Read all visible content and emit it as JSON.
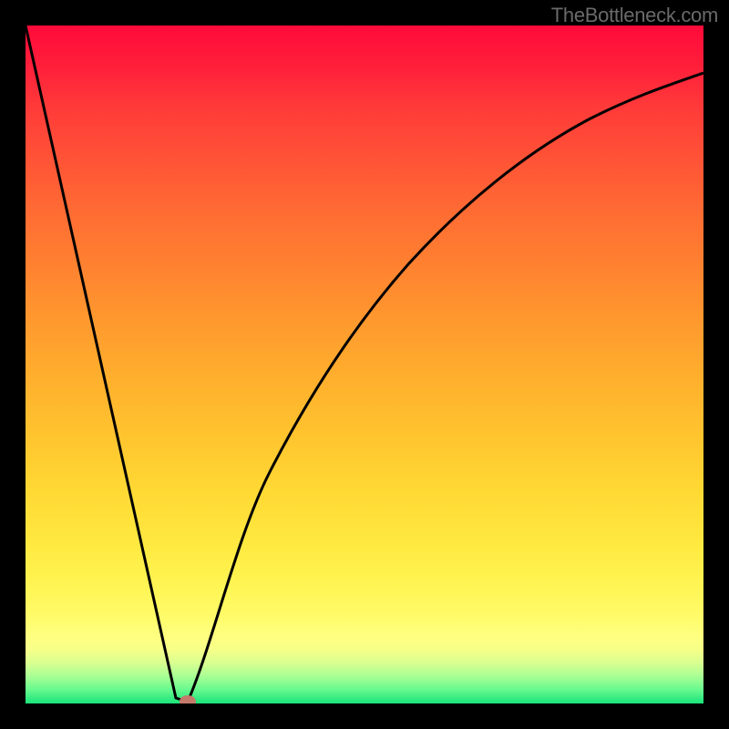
{
  "attribution": "TheBottleneck.com",
  "colors": {
    "page_bg": "#000000",
    "gradient_top": "#ff0a3a",
    "gradient_bottom": "#19e47a",
    "curve_stroke": "#000000",
    "marker_fill": "#c47a6a",
    "attribution_text": "#6a6a6a"
  },
  "chart_data": {
    "type": "line",
    "title": "",
    "xlabel": "",
    "ylabel": "",
    "xlim": [
      0,
      100
    ],
    "ylim": [
      0,
      100
    ],
    "grid": false,
    "series": [
      {
        "name": "curve",
        "x": [
          0,
          22,
          24,
          30,
          36,
          42,
          50,
          58,
          66,
          74,
          82,
          90,
          100
        ],
        "y": [
          100,
          1,
          0,
          16,
          34,
          48,
          61,
          71,
          78,
          83,
          87,
          90,
          93
        ]
      }
    ],
    "marker": {
      "name": "highlight-point",
      "x": 24,
      "y": 0
    }
  }
}
